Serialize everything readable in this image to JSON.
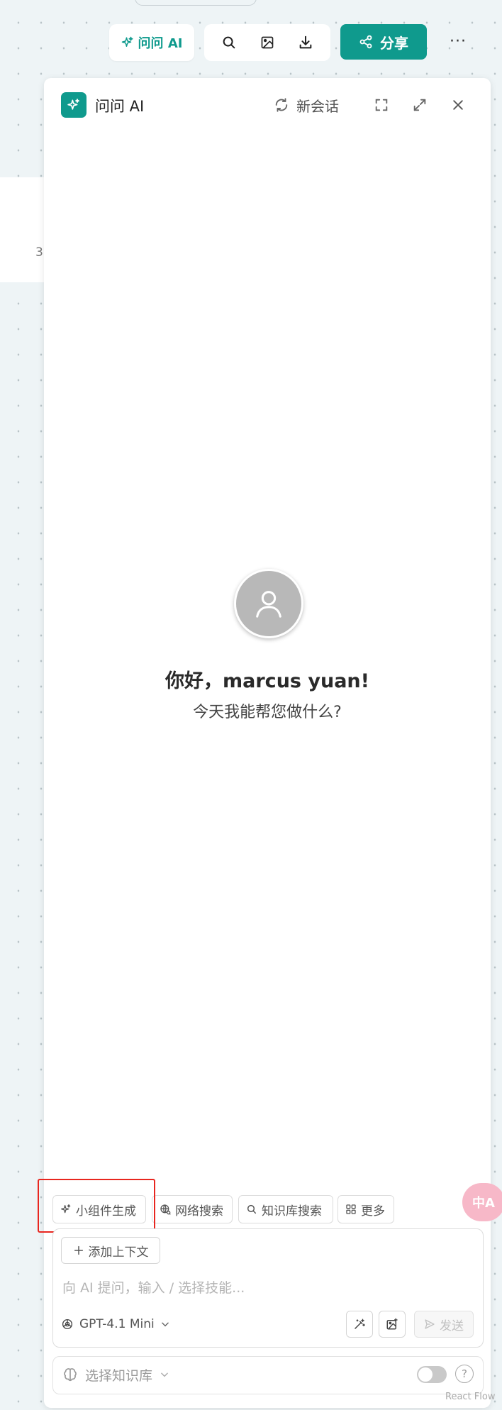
{
  "topbar": {
    "ask_ai_label": "问问 AI",
    "share_label": "分享",
    "more_label": "···",
    "tools": [
      "search-icon",
      "image-icon",
      "download-icon"
    ]
  },
  "background": {
    "card_number": "3"
  },
  "panel": {
    "title": "问问 AI",
    "new_chat_label": "新会话",
    "header_icons": [
      "refresh-icon",
      "fullscreen-icon",
      "expand-icon",
      "close-icon"
    ]
  },
  "greeting": {
    "title": "你好，marcus yuan!",
    "subtitle": "今天我能帮您做什么?"
  },
  "chips": [
    {
      "label": "小组件生成",
      "icon": "sparkle-icon"
    },
    {
      "label": "网络搜索",
      "icon": "globe-icon"
    },
    {
      "label": "知识库搜索",
      "icon": "search-icon"
    },
    {
      "label": "更多",
      "icon": "grid-icon"
    }
  ],
  "input": {
    "add_context_label": "添加上下文",
    "placeholder": "向 AI 提问，输入 / 选择技能...",
    "value": "",
    "model": "GPT-4.1 Mini",
    "send_label": "发送"
  },
  "knowledge": {
    "placeholder": "选择知识库",
    "toggle_on": false,
    "help_label": "?"
  },
  "floating": {
    "translate_label": "中A"
  },
  "watermark": "React Flow",
  "colors": {
    "accent": "#0f9a8d",
    "highlight": "#e8261f",
    "translate": "#f7b8c8"
  }
}
